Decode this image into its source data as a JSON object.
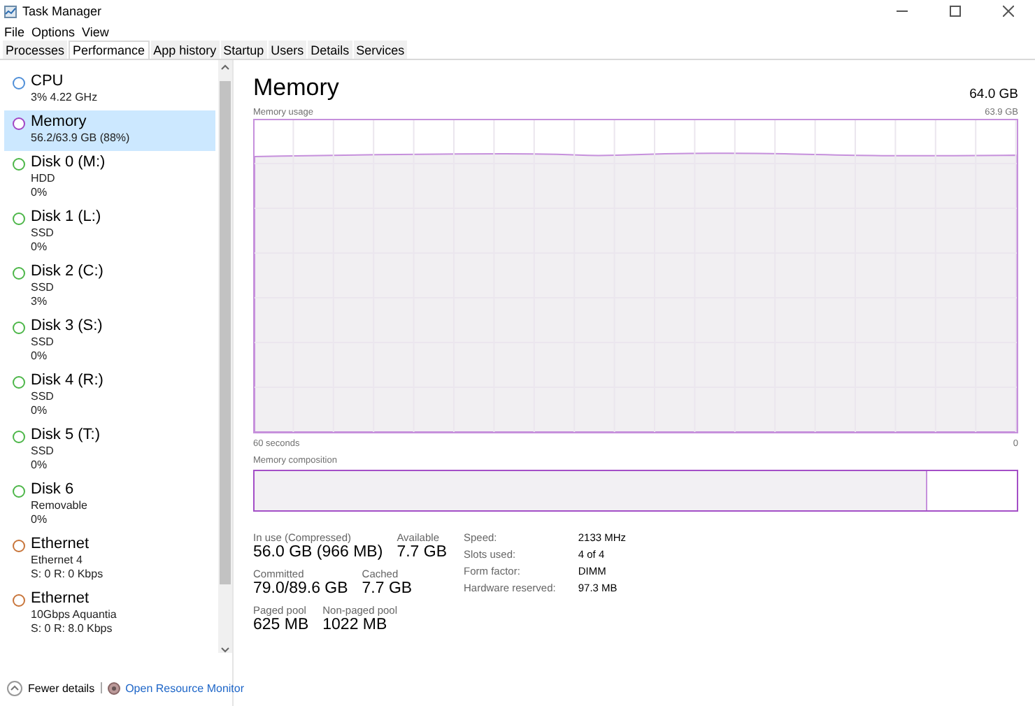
{
  "window": {
    "title": "Task Manager"
  },
  "menu": [
    "File",
    "Options",
    "View"
  ],
  "tabs": [
    {
      "label": "Processes",
      "selected": false
    },
    {
      "label": "Performance",
      "selected": true
    },
    {
      "label": "App history",
      "selected": false
    },
    {
      "label": "Startup",
      "selected": false
    },
    {
      "label": "Users",
      "selected": false
    },
    {
      "label": "Details",
      "selected": false
    },
    {
      "label": "Services",
      "selected": false
    }
  ],
  "sidebar": {
    "items": [
      {
        "name": "CPU",
        "lines": [
          "3% 4.22 GHz"
        ],
        "color": "#4f8fd8",
        "selected": false
      },
      {
        "name": "Memory",
        "lines": [
          "56.2/63.9 GB (88%)"
        ],
        "color": "#a245c4",
        "selected": true
      },
      {
        "name": "Disk 0 (M:)",
        "lines": [
          "HDD",
          "0%"
        ],
        "color": "#4cb648",
        "selected": false
      },
      {
        "name": "Disk 1 (L:)",
        "lines": [
          "SSD",
          "0%"
        ],
        "color": "#4cb648",
        "selected": false
      },
      {
        "name": "Disk 2 (C:)",
        "lines": [
          "SSD",
          "3%"
        ],
        "color": "#4cb648",
        "selected": false
      },
      {
        "name": "Disk 3 (S:)",
        "lines": [
          "SSD",
          "0%"
        ],
        "color": "#4cb648",
        "selected": false
      },
      {
        "name": "Disk 4 (R:)",
        "lines": [
          "SSD",
          "0%"
        ],
        "color": "#4cb648",
        "selected": false
      },
      {
        "name": "Disk 5 (T:)",
        "lines": [
          "SSD",
          "0%"
        ],
        "color": "#4cb648",
        "selected": false
      },
      {
        "name": "Disk 6",
        "lines": [
          "Removable",
          "0%"
        ],
        "color": "#4cb648",
        "selected": false
      },
      {
        "name": "Ethernet",
        "lines": [
          "Ethernet 4",
          "S: 0 R: 0 Kbps"
        ],
        "color": "#c8753a",
        "selected": false
      },
      {
        "name": "Ethernet",
        "lines": [
          "10Gbps Aquantia",
          "S: 0 R: 8.0 Kbps"
        ],
        "color": "#c8753a",
        "selected": false
      }
    ]
  },
  "footer": {
    "fewer_details": "Fewer details",
    "resource_monitor": "Open Resource Monitor"
  },
  "panel": {
    "title": "Memory",
    "total": "64.0 GB",
    "usage_graph": {
      "label": "Memory usage",
      "max": "63.9 GB",
      "left_axis": "60 seconds",
      "right_axis": "0"
    },
    "composition": {
      "label": "Memory composition",
      "level": 0.88
    },
    "stats": [
      [
        {
          "label": "In use (Compressed)",
          "value": "56.0 GB (966 MB)"
        },
        {
          "label": "Available",
          "value": "7.7 GB"
        }
      ],
      [
        {
          "label": "Committed",
          "value": "79.0/89.6 GB"
        },
        {
          "label": "Cached",
          "value": "7.7 GB"
        }
      ],
      [
        {
          "label": "Paged pool",
          "value": "625 MB"
        },
        {
          "label": "Non-paged pool",
          "value": "1022 MB"
        }
      ]
    ],
    "details": [
      {
        "label": "Speed:",
        "value": "2133 MHz"
      },
      {
        "label": "Slots used:",
        "value": "4 of 4"
      },
      {
        "label": "Form factor:",
        "value": "DIMM"
      },
      {
        "label": "Hardware reserved:",
        "value": "97.3 MB"
      }
    ]
  }
}
